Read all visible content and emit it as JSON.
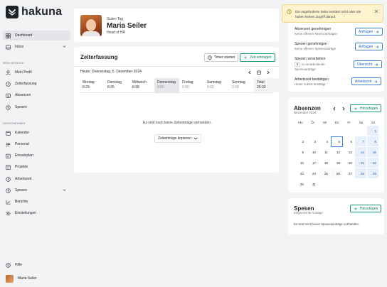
{
  "app": {
    "name": "hakuna"
  },
  "sidebar": {
    "items": [
      {
        "label": "Dashboard",
        "icon": "grid-icon"
      },
      {
        "label": "Inbox",
        "icon": "inbox-icon"
      }
    ],
    "section_mine": "MEIN BEREICH",
    "mine_items": [
      {
        "label": "Mein Profil",
        "icon": "user-icon"
      },
      {
        "label": "Zeiterfassung",
        "icon": "clock-icon"
      },
      {
        "label": "Absenzen",
        "icon": "calendar-x-icon"
      },
      {
        "label": "Spesen",
        "icon": "receipt-icon"
      }
    ],
    "section_company": "UNTERNEHMEN",
    "company_items": [
      {
        "label": "Kalender",
        "icon": "calendar-icon"
      },
      {
        "label": "Personal",
        "icon": "users-icon"
      },
      {
        "label": "Einsatzplan",
        "icon": "schedule-icon"
      },
      {
        "label": "Projekte",
        "icon": "folder-icon"
      },
      {
        "label": "Arbeitszeit",
        "icon": "clock-icon"
      },
      {
        "label": "Spesen",
        "icon": "receipt-icon"
      },
      {
        "label": "Berichte",
        "icon": "chart-icon"
      },
      {
        "label": "Einstellungen",
        "icon": "gear-icon"
      }
    ],
    "help_label": "Hilfe",
    "user_name": "Maria Seiler"
  },
  "profile": {
    "greeting": "Guten Tag",
    "name": "Maria Seiler",
    "role": "Head of HR"
  },
  "zeiterfassung": {
    "title": "Zeiterfassung",
    "timer_label": "Timer starten",
    "add_label": "Zeit eintragen",
    "date_label": "Heute: Donnerstag, 5. Dezember 2024",
    "week": [
      {
        "day": "Montag",
        "value": "8:29"
      },
      {
        "day": "Dienstag",
        "value": "8:25"
      },
      {
        "day": "Mittwoch",
        "value": "8:38"
      },
      {
        "day": "Donnerstag",
        "value": "0:00"
      },
      {
        "day": "Freitag",
        "value": "0:00"
      },
      {
        "day": "Samstag",
        "value": "0:00"
      },
      {
        "day": "Sonntag",
        "value": "0:00"
      },
      {
        "day": "Total",
        "value": "25:32"
      }
    ],
    "empty_text": "Es sind noch keine Zeiteinträge vorhanden.",
    "copy_label": "Zeiteinträge kopieren"
  },
  "notice": {
    "text": "Die angeforderte Seite existiert nicht oder Sie haben keinen Zugriff darauf."
  },
  "tasks": {
    "items": [
      {
        "title": "Absenzen genehmigen",
        "sub": "Keine offenen Absenzanfragen",
        "button": "Anfragen"
      },
      {
        "title": "Spesen genehmigen",
        "sub": "Keine offenen Spesenanträge",
        "button": "Anfragen"
      },
      {
        "title": "Spesen verarbeiten",
        "count": "9",
        "sub": "zu verarbeitende",
        "sub2": "Spesenanträge",
        "button": "Übersicht"
      },
      {
        "title": "Arbeitszeit bestätigen",
        "sub": "Heute zuletzt bestätigt",
        "button": "Arbeitszeit"
      }
    ]
  },
  "absenzen": {
    "title": "Absenzen",
    "subtitle": "Dezember 2024",
    "add_label": "Hinzufügen",
    "weekdays": [
      "Mo",
      "Di",
      "Mi",
      "Do",
      "Fr",
      "Sa",
      "So"
    ],
    "days": [
      "",
      "",
      "",
      "",
      "",
      "",
      "1",
      "2",
      "3",
      "4",
      "5",
      "6",
      "7",
      "8",
      "9",
      "10",
      "11",
      "12",
      "13",
      "14",
      "15",
      "16",
      "17",
      "18",
      "19",
      "20",
      "21",
      "22",
      "23",
      "24",
      "25",
      "26",
      "27",
      "28",
      "29",
      "30",
      "31",
      "",
      "",
      "",
      "",
      ""
    ]
  },
  "spesen": {
    "title": "Spesen",
    "subtitle": "Eingereichte Anträge",
    "add_label": "Hinzufügen",
    "empty_text": "Es sind noch keine Speseneinträge vorhanden."
  },
  "colors": {
    "accent_green": "#1e9b6a",
    "accent_blue": "#3b82d6",
    "notice_bg": "#fdf3cf"
  }
}
